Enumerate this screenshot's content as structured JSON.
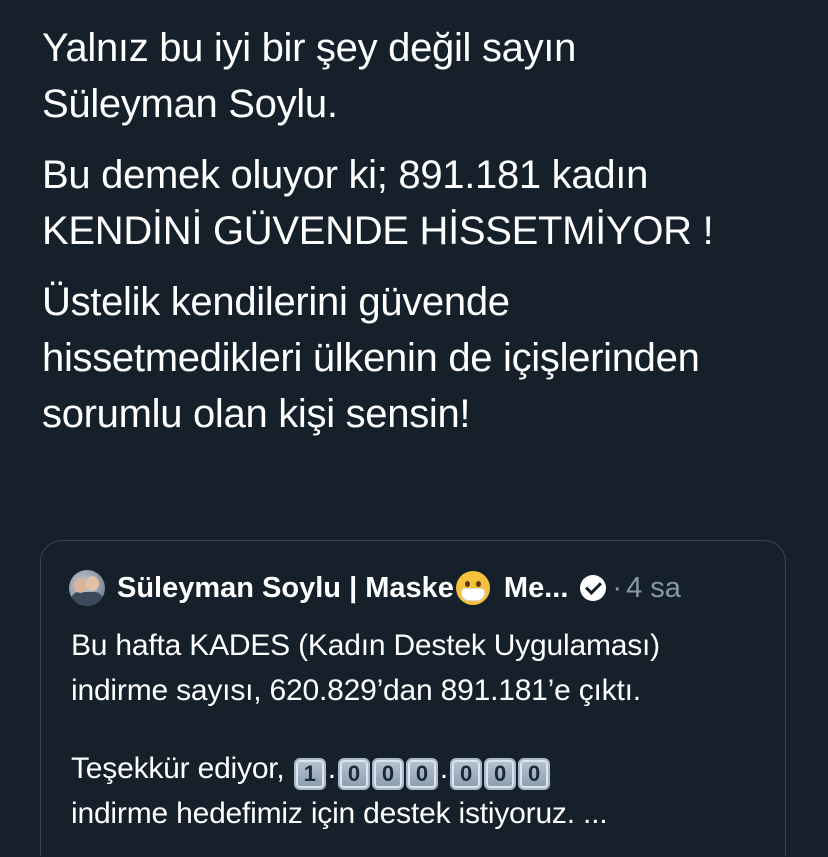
{
  "tweet": {
    "paragraphs": [
      [
        "Yalnız bu iyi bir şey değil sayın",
        "Süleyman Soylu."
      ],
      [
        "Bu demek oluyor ki; 891.181 kadın",
        "KENDİNİ GÜVENDE HİSSETMİYOR !"
      ],
      [
        "Üstelik kendilerini güvende",
        "hissetmedikleri ülkenin de içişlerinden",
        "sorumlu olan kişi sensin!"
      ]
    ]
  },
  "quote": {
    "author_name": "Süleyman Soylu | Maske",
    "author_name_tail": "Me...",
    "mask_icon": "face-with-medical-mask-icon",
    "verified_icon": "verified-badge-icon",
    "separator": "·",
    "time": "4 sa",
    "body": {
      "line1": "Bu hafta KADES (Kadın Destek Uygulaması)",
      "line2": "indirme sayısı, 620.829’dan 891.181’e çıktı.",
      "line3_prefix": "Teşekkür ediyor,",
      "keycaps": [
        "1",
        ".",
        "0",
        "0",
        "0",
        ".",
        "0",
        "0",
        "0"
      ],
      "line4": "indirme hedefimiz için destek istiyoruz. ..."
    }
  },
  "colors": {
    "background": "#15202b",
    "text": "#ffffff",
    "secondary_text": "#8899a6",
    "border": "#38444d"
  }
}
